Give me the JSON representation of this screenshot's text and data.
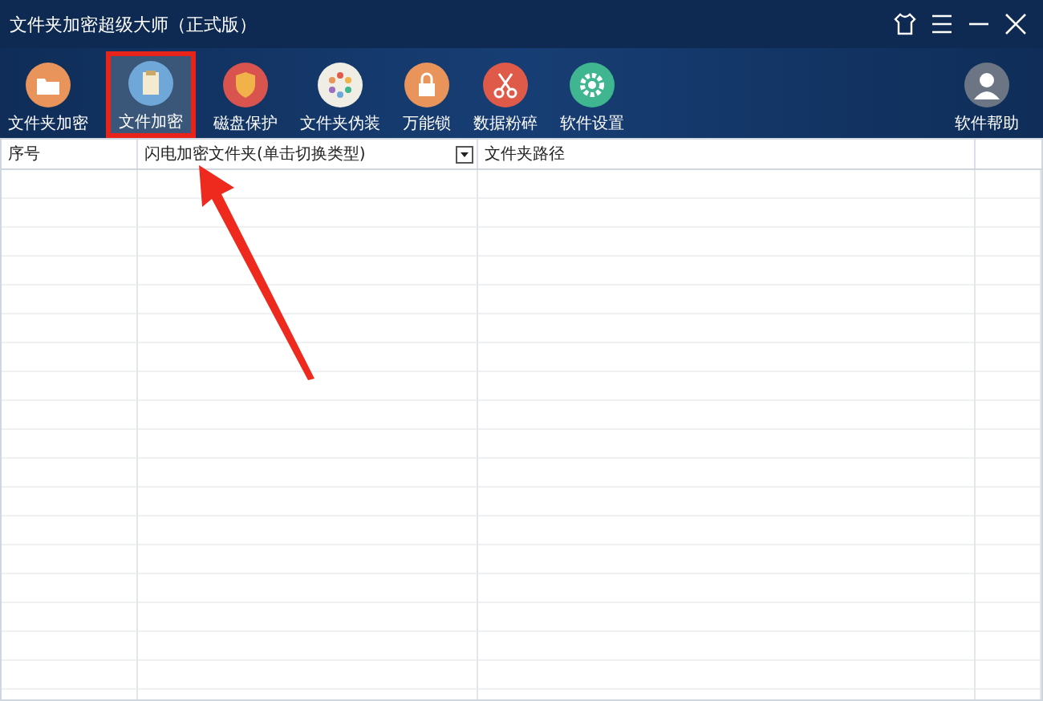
{
  "window": {
    "title": "文件夹加密超级大师（正式版）"
  },
  "toolbar": [
    {
      "label": "文件夹加密",
      "kind": "folder",
      "selected": false
    },
    {
      "label": "文件加密",
      "kind": "clipboard",
      "selected": true
    },
    {
      "label": "磁盘保护",
      "kind": "shield",
      "selected": false
    },
    {
      "label": "文件夹伪装",
      "kind": "palette",
      "selected": false
    },
    {
      "label": "万能锁",
      "kind": "lock",
      "selected": false
    },
    {
      "label": "数据粉碎",
      "kind": "scissors",
      "selected": false
    },
    {
      "label": "软件设置",
      "kind": "gear",
      "selected": false
    },
    {
      "label": "软件帮助",
      "kind": "user",
      "selected": false
    }
  ],
  "table": {
    "columns": [
      {
        "label": "序号",
        "kind": "plain"
      },
      {
        "label": "闪电加密文件夹(单击切换类型)",
        "kind": "dropdown"
      },
      {
        "label": "文件夹路径",
        "kind": "plain"
      }
    ]
  }
}
